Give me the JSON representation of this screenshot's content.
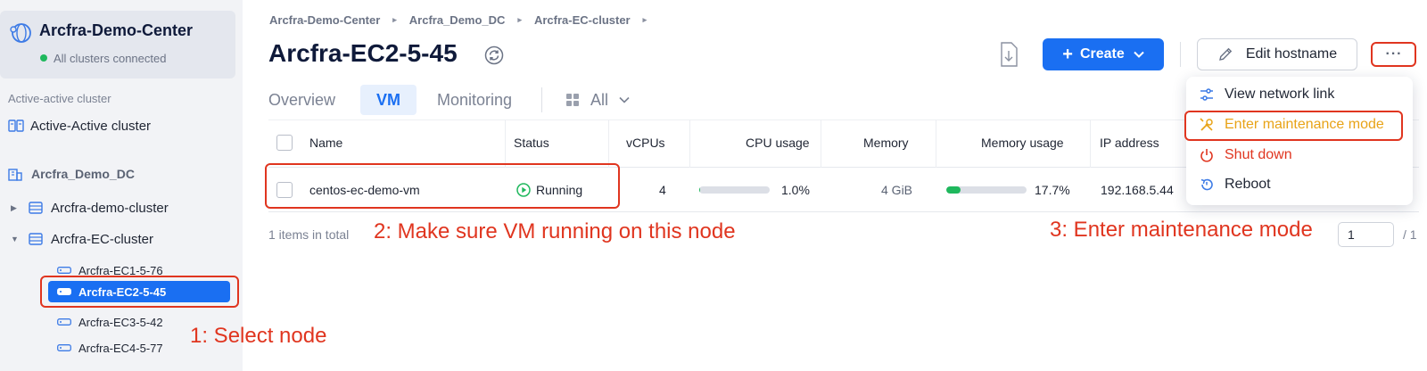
{
  "sidebar": {
    "center_title": "Arcfra-Demo-Center",
    "center_status": "All clusters connected",
    "group_label": "Active-active cluster",
    "active_active_item": "Active-Active cluster",
    "datacenter": "Arcfra_Demo_DC",
    "clusters": [
      "Arcfra-demo-cluster",
      "Arcfra-EC-cluster"
    ],
    "nodes": [
      "Arcfra-EC1-5-76",
      "Arcfra-EC2-5-45",
      "Arcfra-EC3-5-42",
      "Arcfra-EC4-5-77"
    ],
    "selected_node": "Arcfra-EC2-5-45"
  },
  "breadcrumb": [
    "Arcfra-Demo-Center",
    "Arcfra_Demo_DC",
    "Arcfra-EC-cluster"
  ],
  "page_title": "Arcfra-EC2-5-45",
  "toolbar": {
    "create_label": "Create",
    "edit_hostname_label": "Edit hostname",
    "more_label": "···"
  },
  "tabs": {
    "overview": "Overview",
    "vm": "VM",
    "monitoring": "Monitoring",
    "filter": "All"
  },
  "table": {
    "headers": [
      "Name",
      "Status",
      "vCPUs",
      "CPU usage",
      "Memory",
      "Memory usage",
      "IP address"
    ],
    "rows": [
      {
        "name": "centos-ec-demo-vm",
        "status": "Running",
        "vcpus": "4",
        "cpu_usage": "1.0%",
        "cpu_usage_value": 1.0,
        "memory": "4 GiB",
        "memory_usage": "17.7%",
        "memory_usage_value": 17.7,
        "ip": "192.168.5.44"
      }
    ],
    "total": "1 items in total"
  },
  "menu": {
    "items": [
      "View network link",
      "Enter maintenance mode",
      "Shut down",
      "Reboot"
    ]
  },
  "pagination": {
    "page": "1",
    "total_pages": "/ 1"
  },
  "annotations": {
    "step1": "1: Select node",
    "step2": "2: Make sure VM running on this node",
    "step3": "3: Enter maintenance mode"
  },
  "colors": {
    "accent": "#1a6ff2",
    "annotation": "#e0351f",
    "success": "#1fb85d",
    "warning": "#e8a317"
  }
}
